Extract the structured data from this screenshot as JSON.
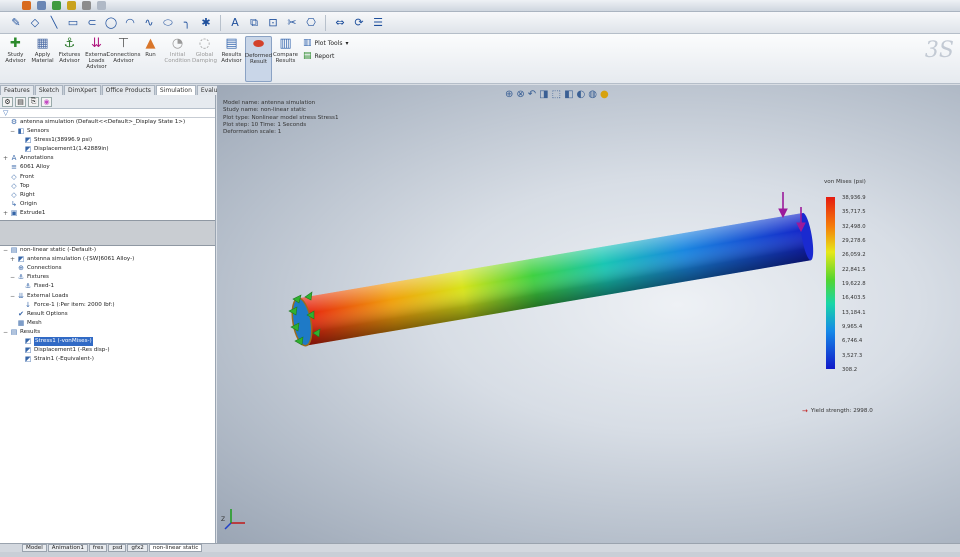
{
  "toolbar": {
    "items": [
      "sketch-icon",
      "smart-dimension-icon",
      "line-icon",
      "rectangle-icon",
      "slot-icon",
      "circle-icon",
      "arc-icon",
      "spline-icon",
      "ellipse-icon",
      "fillet-icon",
      "point-icon",
      "text-icon",
      "mirror-icon",
      "offset-icon",
      "trim-icon",
      "convert-icon",
      "move-icon",
      "rebuild-icon",
      "options-icon"
    ]
  },
  "ribbon": {
    "buttons": [
      {
        "name": "study-advisor",
        "label": "Study Advisor",
        "icon": "✚",
        "color": "#2c8a2c"
      },
      {
        "name": "apply-material",
        "label": "Apply Material",
        "icon": "▦",
        "color": "#4d6da6"
      },
      {
        "name": "fixtures-advisor",
        "label": "Fixtures Advisor",
        "icon": "⚓",
        "color": "#2f7a2f"
      },
      {
        "name": "external-loads-advisor",
        "label": "External Loads Advisor",
        "icon": "⇊",
        "color": "#b01a80"
      },
      {
        "name": "connections-advisor",
        "label": "Connections Advisor",
        "icon": "⊤",
        "color": "#555"
      },
      {
        "name": "run",
        "label": "Run",
        "icon": "▲",
        "color": "#d9762a"
      },
      {
        "name": "initial-condition",
        "label": "Initial Condition",
        "icon": "◔",
        "color": "#999"
      },
      {
        "name": "global-damping",
        "label": "Global Damping",
        "icon": "◌",
        "color": "#999"
      },
      {
        "name": "results-advisor",
        "label": "Results Advisor",
        "icon": "▤",
        "color": "#3a6ab0"
      },
      {
        "name": "deformed-result",
        "label": "Deformed Result",
        "icon": "⬬",
        "color": "#d3412a"
      },
      {
        "name": "compare-results",
        "label": "Compare Results",
        "icon": "▥",
        "color": "#3a6ab0"
      }
    ],
    "plot_tools": "Plot Tools",
    "report": "Report"
  },
  "cm_tabs": [
    "Features",
    "Sketch",
    "DimXpert",
    "Office Products",
    "Simulation",
    "Evaluate"
  ],
  "cm_tab_selected": 4,
  "feature_tree": [
    {
      "text": "antenna simulation  (Default<<Default>_Display State 1>)",
      "icon": "⚙",
      "pm": "",
      "indent": 0
    },
    {
      "text": "Sensors",
      "icon": "◧",
      "pm": "−",
      "indent": 1
    },
    {
      "text": "Stress1(38996.9 psi)",
      "icon": "◩",
      "pm": "",
      "indent": 2
    },
    {
      "text": "Displacement1(1.42889in)",
      "icon": "◩",
      "pm": "",
      "indent": 2
    },
    {
      "text": "Annotations",
      "icon": "A",
      "pm": "+",
      "indent": 0
    },
    {
      "text": "6061 Alloy",
      "icon": "≡",
      "pm": "",
      "indent": 0
    },
    {
      "text": "Front",
      "icon": "◇",
      "pm": "",
      "indent": 0
    },
    {
      "text": "Top",
      "icon": "◇",
      "pm": "",
      "indent": 0
    },
    {
      "text": "Right",
      "icon": "◇",
      "pm": "",
      "indent": 0
    },
    {
      "text": "Origin",
      "icon": "↳",
      "pm": "",
      "indent": 0
    },
    {
      "text": "Extrude1",
      "icon": "▣",
      "pm": "+",
      "indent": 0
    }
  ],
  "study_tree": [
    {
      "text": "non-linear static (-Default-)",
      "icon": "▤",
      "pm": "−",
      "indent": 0,
      "hl": false
    },
    {
      "text": "antenna simulation (-[SW]6061 Alloy-)",
      "icon": "◩",
      "pm": "+",
      "indent": 1,
      "hl": false
    },
    {
      "text": "Connections",
      "icon": "⊕",
      "pm": "",
      "indent": 1,
      "hl": false
    },
    {
      "text": "Fixtures",
      "icon": "⚓",
      "pm": "−",
      "indent": 1,
      "hl": false
    },
    {
      "text": "Fixed-1",
      "icon": "⚓",
      "pm": "",
      "indent": 2,
      "hl": false
    },
    {
      "text": "External Loads",
      "icon": "⇊",
      "pm": "−",
      "indent": 1,
      "hl": false
    },
    {
      "text": "Force-1 (:Per item: 2000 lbf:)",
      "icon": "↓",
      "pm": "",
      "indent": 2,
      "hl": false
    },
    {
      "text": "Result Options",
      "icon": "✔",
      "pm": "",
      "indent": 1,
      "hl": false
    },
    {
      "text": "Mesh",
      "icon": "▦",
      "pm": "",
      "indent": 1,
      "hl": false
    },
    {
      "text": "Results",
      "icon": "▤",
      "pm": "−",
      "indent": 0,
      "hl": false
    },
    {
      "text": "Stress1 (-vonMises-)",
      "icon": "◩",
      "pm": "",
      "indent": 2,
      "hl": true
    },
    {
      "text": "Displacement1 (-Res disp-)",
      "icon": "◩",
      "pm": "",
      "indent": 2,
      "hl": false
    },
    {
      "text": "Strain1 (-Equivalent-)",
      "icon": "◩",
      "pm": "",
      "indent": 2,
      "hl": false
    }
  ],
  "model_info": [
    "Model name: antenna simulation",
    "Study name: non-linear static",
    "Plot type: Nonlinear model stress Stress1",
    "Plot step: 10  Time: 1 Seconds",
    "Deformation scale: 1"
  ],
  "legend": {
    "title": "von Mises (psi)",
    "ticks": [
      "38,936.9",
      "35,717.5",
      "32,498.0",
      "29,278.6",
      "26,059.2",
      "22,841.5",
      "19,622.8",
      "16,403.5",
      "13,184.1",
      "9,965.4",
      "6,746.4",
      "3,527.3",
      "308.2"
    ],
    "yield": "Yield strength: 2998.0"
  },
  "bottom_tabs": [
    "Model",
    "Animation1",
    "fres",
    "psd",
    "gfx2",
    "non-linear static"
  ],
  "bottom_tab_selected": 5
}
